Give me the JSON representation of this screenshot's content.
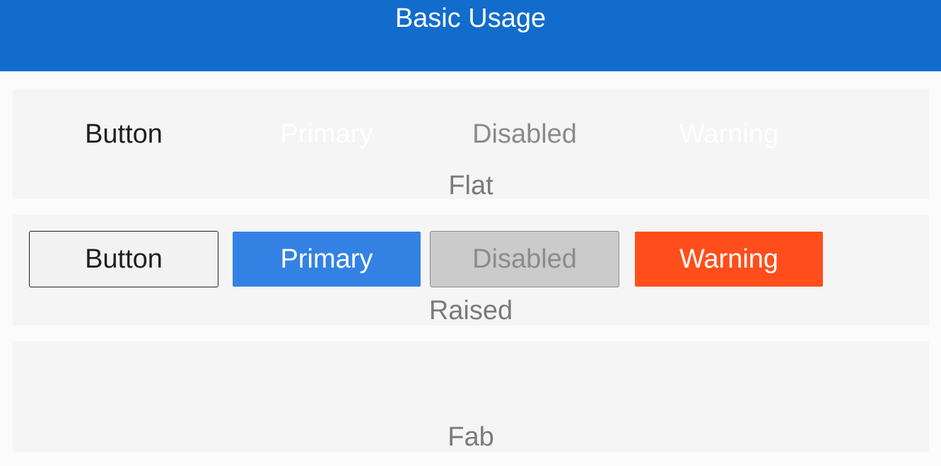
{
  "header": {
    "title": "Basic Usage"
  },
  "sections": {
    "flat": {
      "label": "Flat",
      "buttons": [
        "Button",
        "Primary",
        "Disabled",
        "Warning"
      ]
    },
    "raised": {
      "label": "Raised",
      "buttons": [
        "Button",
        "Primary",
        "Disabled",
        "Warning"
      ]
    },
    "fab": {
      "label": "Fab"
    }
  },
  "colors": {
    "header_bg": "#116ccb",
    "primary": "#3382e3",
    "warning": "#ff4e1b",
    "disabled": "#cbcbcb",
    "default": "#f2f2f2",
    "panel_bg": "#f5f5f5"
  }
}
